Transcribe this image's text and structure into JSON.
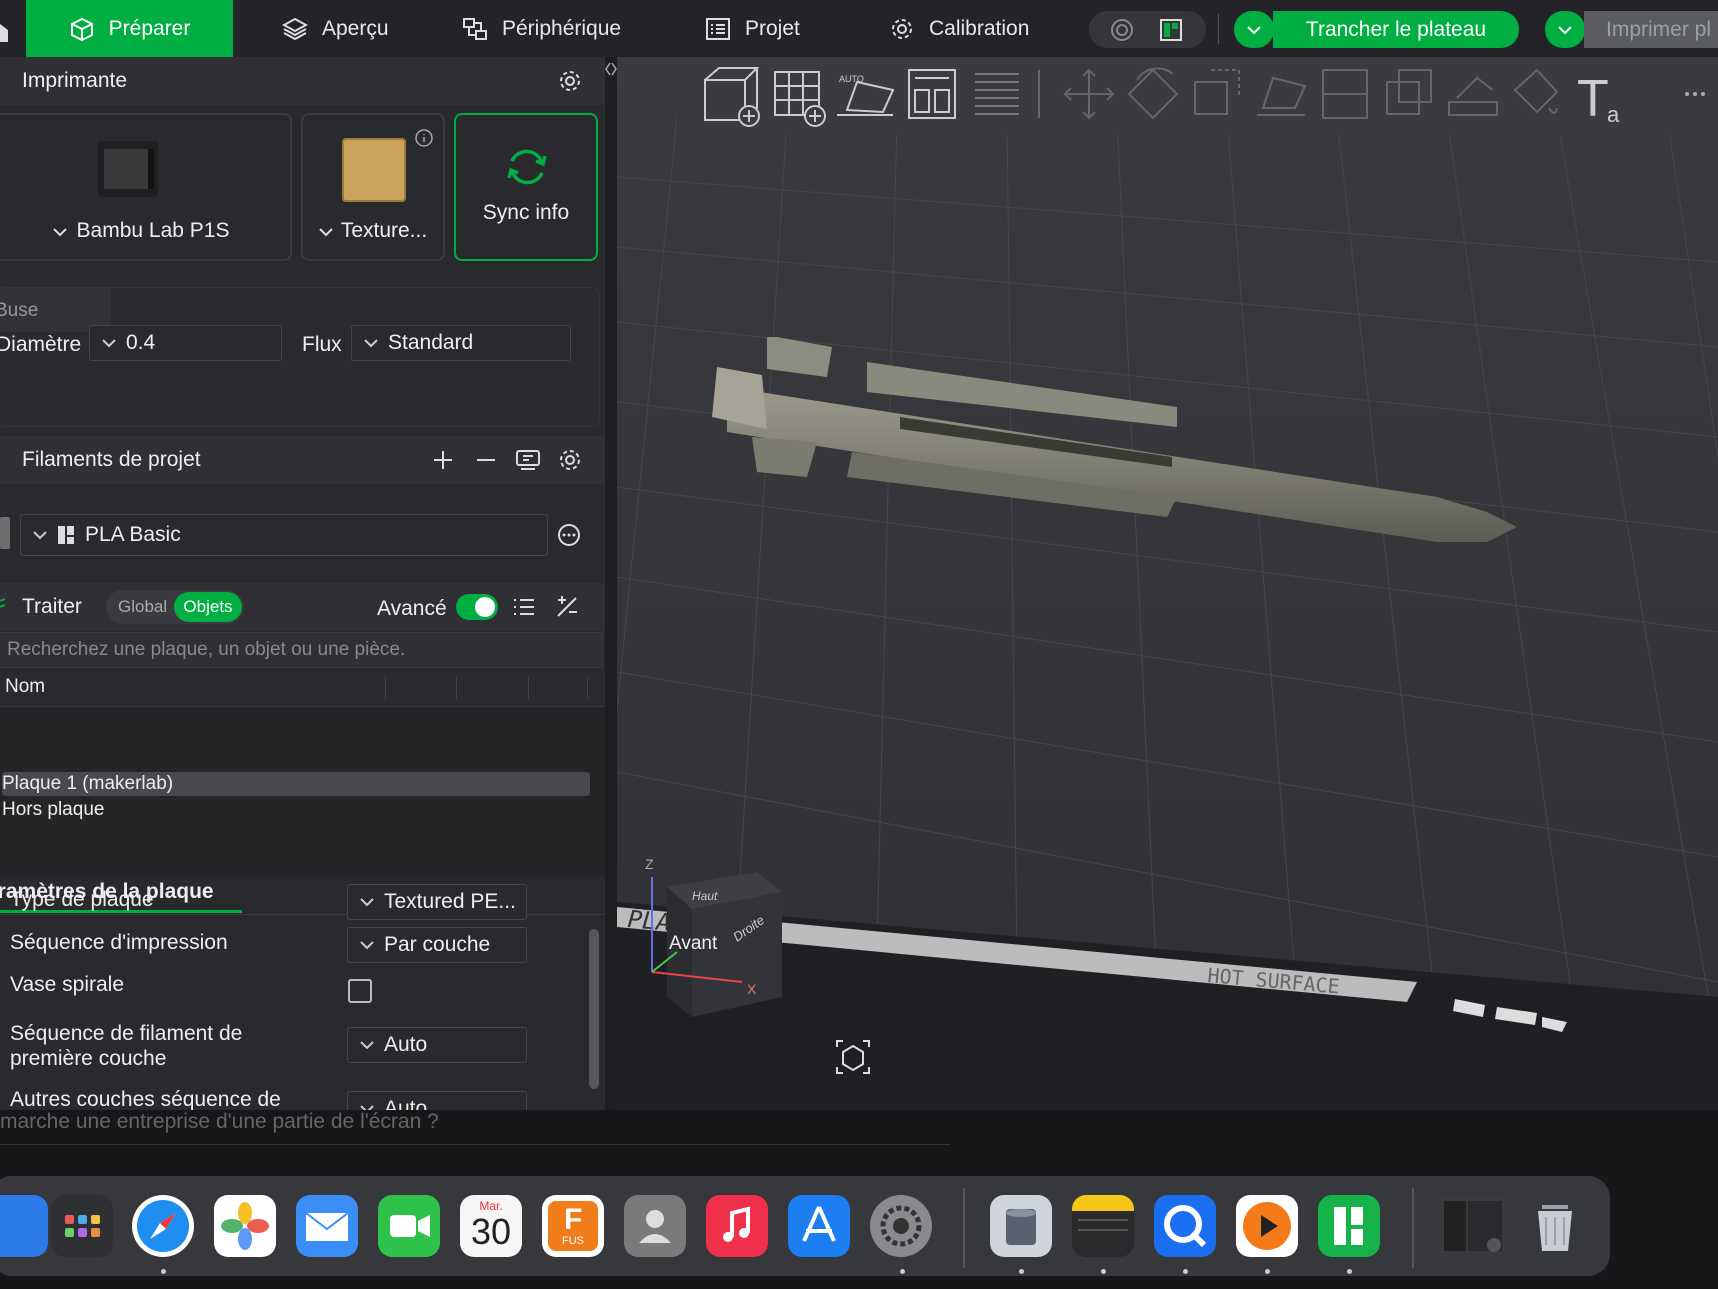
{
  "topbar": {
    "tabs": [
      {
        "label": "Préparer",
        "icon": "cube-icon"
      },
      {
        "label": "Aperçu",
        "icon": "layers-icon"
      },
      {
        "label": "Périphérique",
        "icon": "device-icon"
      },
      {
        "label": "Projet",
        "icon": "list-icon"
      },
      {
        "label": "Calibration",
        "icon": "gear-icon"
      }
    ],
    "slice_label": "Trancher le plateau",
    "print_label": "Imprimer pl"
  },
  "printer": {
    "section_title": "Imprimante",
    "printer_name": "Bambu Lab P1S",
    "plate_name": "Texture...",
    "sync_label": "Sync info"
  },
  "nozzle": {
    "title": "Buse",
    "diameter_label": "Diamètre",
    "diameter_value": "0.4",
    "flow_label": "Flux",
    "flow_value": "Standard"
  },
  "filaments": {
    "title": "Filaments de projet",
    "items": [
      {
        "name": "PLA Basic",
        "color": "#6f6f6f"
      }
    ]
  },
  "process": {
    "title": "Traiter",
    "mode_global": "Global",
    "mode_objects": "Objets",
    "advanced_label": "Avancé",
    "advanced_on": true,
    "search_placeholder": "Recherchez une plaque, un objet ou une pièce.",
    "column_name": "Nom",
    "rows": [
      "Plaque 1 (makerlab)",
      "Hors plaque"
    ]
  },
  "plate_settings": {
    "tab_label": "aramètres de la plaque",
    "rows": [
      {
        "label": "Type de plaque",
        "value": "Textured PE..."
      },
      {
        "label": "Séquence d'impression",
        "value": "Par couche"
      },
      {
        "label": "Vase spirale",
        "checked": false
      },
      {
        "label": "Séquence de filament de première couche",
        "value": "Auto"
      },
      {
        "label": "Autres couches séquence de",
        "value": "Auto"
      }
    ]
  },
  "viewport": {
    "bed_text": "PLA/PETG",
    "bed_warning": "HOT SURFACE",
    "cube_top": "Haut",
    "cube_front": "Avant",
    "cube_right": "Droite",
    "axis_x": "X",
    "axis_z": "Z"
  },
  "dock": {
    "calendar_month": "Mar.",
    "calendar_day": "30",
    "fusion_label": "FUS",
    "underlay_text": "marche une entreprise d'une partie de l'écran ?"
  },
  "colors": {
    "accent": "#00ae42",
    "panel": "#2a2a2e",
    "viewport": "#3a3b3f"
  }
}
